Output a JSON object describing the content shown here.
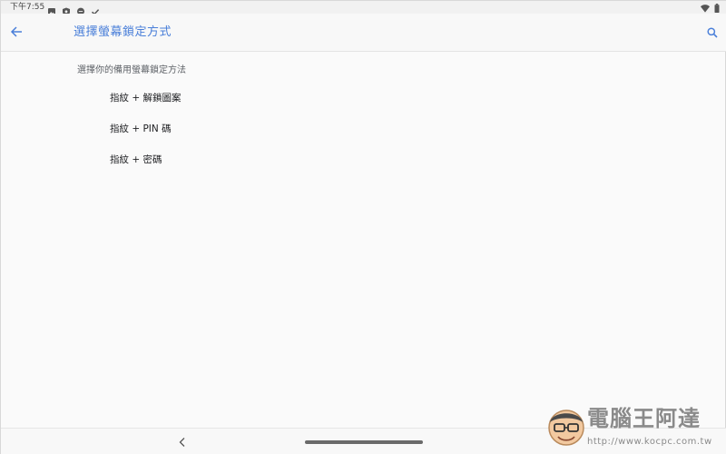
{
  "status_bar": {
    "time": "下午7:55",
    "icons_left": [
      "image-icon",
      "shield-icon",
      "chat-icon",
      "check-icon"
    ],
    "icons_right": [
      "wifi-icon",
      "battery-icon"
    ]
  },
  "app_bar": {
    "back_icon": "arrow-left-icon",
    "title": "選擇螢幕鎖定方式",
    "search_icon": "search-icon",
    "accent_color": "#4a7fd9"
  },
  "content": {
    "section_header": "選擇你的備用螢幕鎖定方法",
    "options": [
      {
        "label": "指紋 + 解鎖圖案"
      },
      {
        "label": "指紋 + PIN 碼"
      },
      {
        "label": "指紋 + 密碼"
      }
    ]
  },
  "nav_bar": {
    "back_icon": "chevron-left-icon",
    "home_icon": "home-pill"
  },
  "watermark": {
    "title": "電腦王阿達",
    "url": "http://www.kocpc.com.tw"
  }
}
